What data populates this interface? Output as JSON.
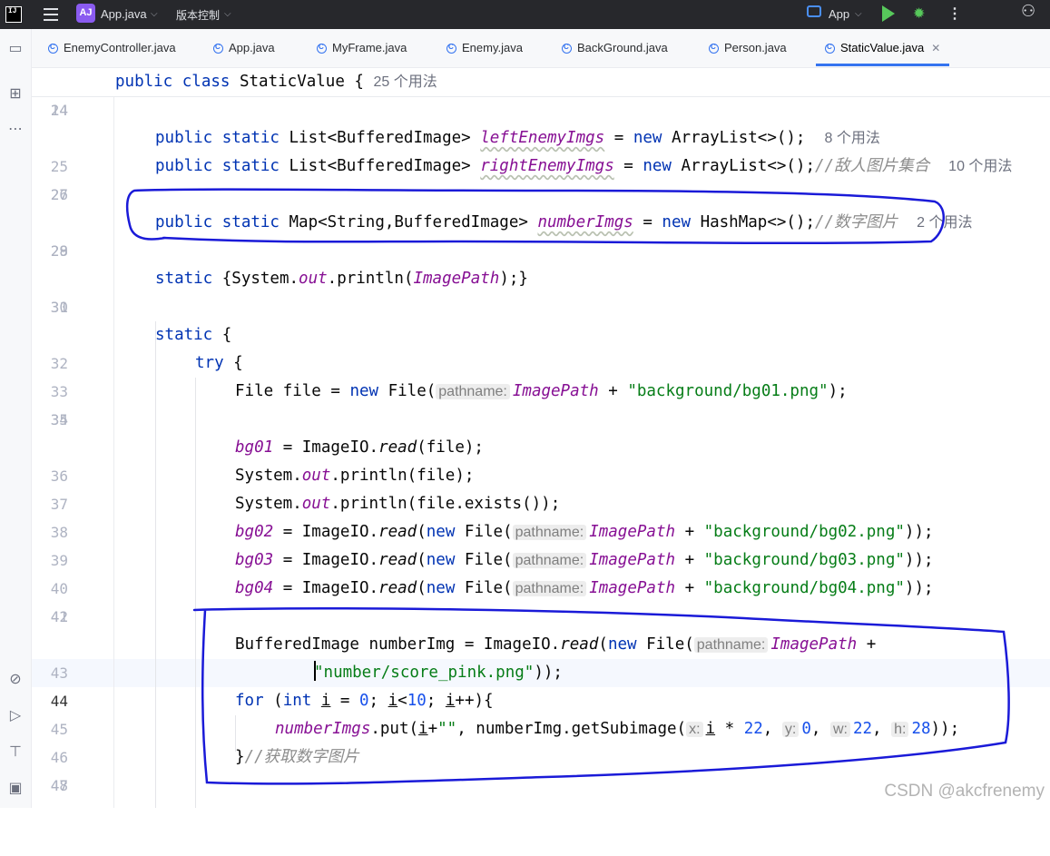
{
  "titlebar": {
    "logo_text": "IJ",
    "project_badge": "AJ",
    "project_name": "App.java",
    "vcs_label": "版本控制",
    "run_config": "App",
    "icons": [
      "hamburger-icon",
      "run-icon",
      "debug-icon",
      "more-icon",
      "add-user-icon"
    ]
  },
  "toolstrip": {
    "icons": [
      "folder-icon",
      "structure-icon",
      "more-icon",
      "services-icon",
      "run-icon",
      "build-icon",
      "terminal-icon"
    ]
  },
  "tabs": [
    {
      "label": "EnemyController.java",
      "active": false
    },
    {
      "label": "App.java",
      "active": false
    },
    {
      "label": "MyFrame.java",
      "active": false
    },
    {
      "label": "Enemy.java",
      "active": false
    },
    {
      "label": "BackGround.java",
      "active": false
    },
    {
      "label": "Person.java",
      "active": false
    },
    {
      "label": "StaticValue.java",
      "active": true
    }
  ],
  "editor": {
    "sticky": {
      "ln": "14",
      "kw": "public class",
      "name": " StaticValue {",
      "usage": "25 个用法"
    },
    "lines": {
      "l24": {
        "ln": "24"
      },
      "l25": {
        "ln": "25",
        "kw1": "public static",
        "t1": " List<BufferedImage> ",
        "fld": "leftEnemyImgs",
        "t2": " = ",
        "kw2": "new",
        "t3": " ArrayList<>();",
        "usage": "8 个用法"
      },
      "l26": {
        "ln": "26",
        "kw1": "public static",
        "t1": " List<BufferedImage> ",
        "fld": "rightEnemyImgs",
        "t2": " = ",
        "kw2": "new",
        "t3": " ArrayList<>();",
        "cmt": "//敌人图片集合",
        "usage": "10 个用法"
      },
      "l27": {
        "ln": "27"
      },
      "l28": {
        "ln": "28",
        "kw1": "public static",
        "t1": " Map<String,BufferedImage> ",
        "fld": "numberImgs",
        "t2": " = ",
        "kw2": "new",
        "t3": " HashMap<>();",
        "cmt": "//数字图片",
        "usage": "2 个用法"
      },
      "l29": {
        "ln": "29"
      },
      "l30": {
        "ln": "30",
        "kw1": "static",
        "t1": " {System.",
        "fld": "out",
        "t2": ".println(",
        "fld2": "ImagePath",
        "t3": ");}"
      },
      "l31": {
        "ln": "31"
      },
      "l32": {
        "ln": "32",
        "kw1": "static",
        "t1": " {"
      },
      "l33": {
        "ln": "33",
        "kw1": "try",
        "t1": " {"
      },
      "l34": {
        "ln": "34",
        "t1": "File file = ",
        "kw1": "new",
        "t2": " File(",
        "hint": "pathname:",
        "fld": "ImagePath",
        "t3": " + ",
        "str": "\"background/bg01.png\"",
        "t4": ");"
      },
      "l35": {
        "ln": "35"
      },
      "l36": {
        "ln": "36",
        "fld": "bg01",
        "t1": " = ImageIO.",
        "m": "read",
        "t2": "(file);"
      },
      "l37": {
        "ln": "37",
        "t1": "System.",
        "fld": "out",
        "t2": ".println(file);"
      },
      "l38": {
        "ln": "38",
        "t1": "System.",
        "fld": "out",
        "t2": ".println(file.exists());"
      },
      "l39": {
        "ln": "39",
        "fld": "bg02",
        "t1": " = ImageIO.",
        "m": "read",
        "t2": "(",
        "kw1": "new",
        "t3": " File(",
        "hint": "pathname:",
        "fld2": "ImagePath",
        "t4": " + ",
        "str": "\"background/bg02.png\"",
        "t5": "));"
      },
      "l40": {
        "ln": "40",
        "fld": "bg03",
        "t1": " = ImageIO.",
        "m": "read",
        "t2": "(",
        "kw1": "new",
        "t3": " File(",
        "hint": "pathname:",
        "fld2": "ImagePath",
        "t4": " + ",
        "str": "\"background/bg03.png\"",
        "t5": "));"
      },
      "l41": {
        "ln": "41",
        "fld": "bg04",
        "t1": " = ImageIO.",
        "m": "read",
        "t2": "(",
        "kw1": "new",
        "t3": " File(",
        "hint": "pathname:",
        "fld2": "ImagePath",
        "t4": " + ",
        "str": "\"background/bg04.png\"",
        "t5": "));"
      },
      "l42": {
        "ln": "42"
      },
      "l43": {
        "ln": "43",
        "t1": "BufferedImage numberImg = ImageIO.",
        "m": "read",
        "t2": "(",
        "kw1": "new",
        "t3": " File(",
        "hint": "pathname:",
        "fld": "ImagePath",
        "t4": " +"
      },
      "l44": {
        "ln": "44",
        "str": "\"number/score_pink.png\"",
        "t1": "));"
      },
      "l45": {
        "ln": "45",
        "kw1": "for",
        "t1": " (",
        "kw2": "int",
        "t2": " ",
        "v1": "i",
        "t3": " = ",
        "n1": "0",
        "t4": "; ",
        "v2": "i",
        "t5": "<",
        "n2": "10",
        "t6": "; ",
        "v3": "i",
        "t7": "++){"
      },
      "l46": {
        "ln": "46",
        "fld": "numberImgs",
        "t1": ".put(",
        "v1": "i",
        "t2": "+",
        "str": "\"\"",
        "t3": ", numberImg.getSubimage(",
        "h1": "x:",
        "v2": "i",
        "t4": " * ",
        "n1": "22",
        "t5": ", ",
        "h2": "y:",
        "n2": "0",
        "t6": ", ",
        "h3": "w:",
        "n3": "22",
        "t7": ", ",
        "h4": "h:",
        "n4": "28",
        "t8": "));"
      },
      "l47": {
        "ln": "47",
        "t1": "}",
        "cmt": "//获取数字图片"
      },
      "l48": {
        "ln": "48"
      }
    }
  },
  "watermark": "CSDN @akcfrenemy",
  "colors": {
    "keyword": "#0033b3",
    "field": "#871094",
    "string": "#067d17",
    "number": "#1750eb",
    "comment": "#8c8c8c",
    "annotation_ink": "#1a1ad8",
    "accent": "#3574f0"
  }
}
